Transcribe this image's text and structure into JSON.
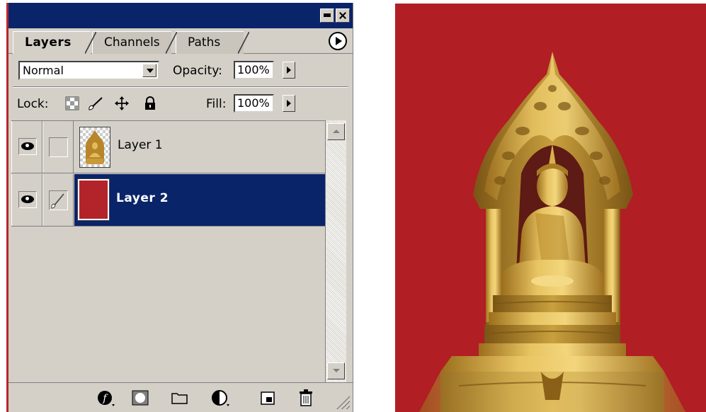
{
  "palette": {
    "tabs": [
      {
        "label": "Layers",
        "active": true
      },
      {
        "label": "Channels",
        "active": false
      },
      {
        "label": "Paths",
        "active": false
      }
    ],
    "blend_mode": "Normal",
    "opacity_label": "Opacity:",
    "opacity_value": "100%",
    "lock_label": "Lock:",
    "fill_label": "Fill:",
    "fill_value": "100%",
    "layers": [
      {
        "name": "Layer 1",
        "visible": true,
        "selected": false,
        "thumbnail": "buddha-on-transparent"
      },
      {
        "name": "Layer 2",
        "visible": true,
        "selected": true,
        "thumbnail": "solid-red"
      }
    ],
    "bottom_icons": [
      "layer-style-icon",
      "layer-mask-icon",
      "new-folder-icon",
      "adjustment-layer-icon",
      "new-layer-icon",
      "trash-icon"
    ]
  },
  "colors": {
    "selection": "#0a246a",
    "canvas_red": "#b11e24",
    "gold": "#d4a93c"
  }
}
